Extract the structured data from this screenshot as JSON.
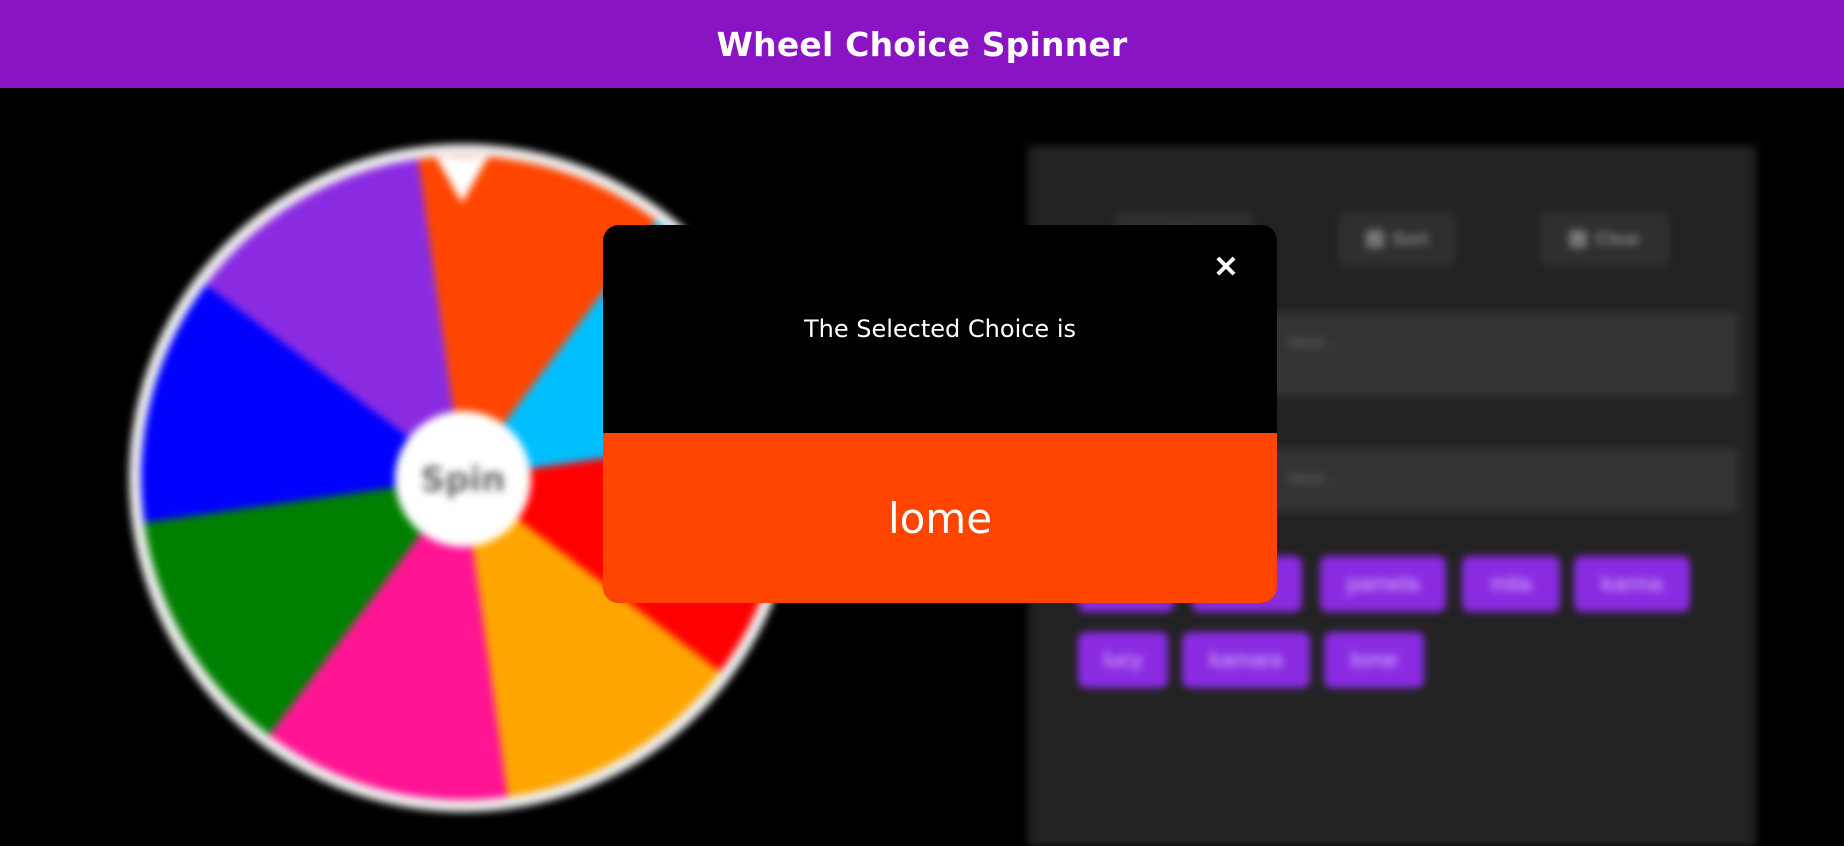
{
  "header": {
    "title": "Wheel Choice Spinner"
  },
  "wheel": {
    "spin_label": "Spin",
    "segment_colors": [
      "#ff4500",
      "#00bfff",
      "#ff0000",
      "#ffa500",
      "#ff1493",
      "#008000",
      "#0000ff",
      "#8a2be2"
    ]
  },
  "panel": {
    "tools": [
      {
        "label": "",
        "icon": "shuffle-icon"
      },
      {
        "label": "Sort",
        "icon": "sort-icon"
      },
      {
        "label": "Clear",
        "icon": "broom-icon"
      }
    ],
    "textarea_placeholder": "here...",
    "input_placeholder": "here...",
    "chips": [
      "",
      "",
      "pamela",
      "mila",
      "karma",
      "lucy",
      "kamara",
      "lome"
    ]
  },
  "modal": {
    "close_symbol": "✕",
    "heading": "The Selected Choice is",
    "result": "lome",
    "result_color": "#ff4500"
  }
}
